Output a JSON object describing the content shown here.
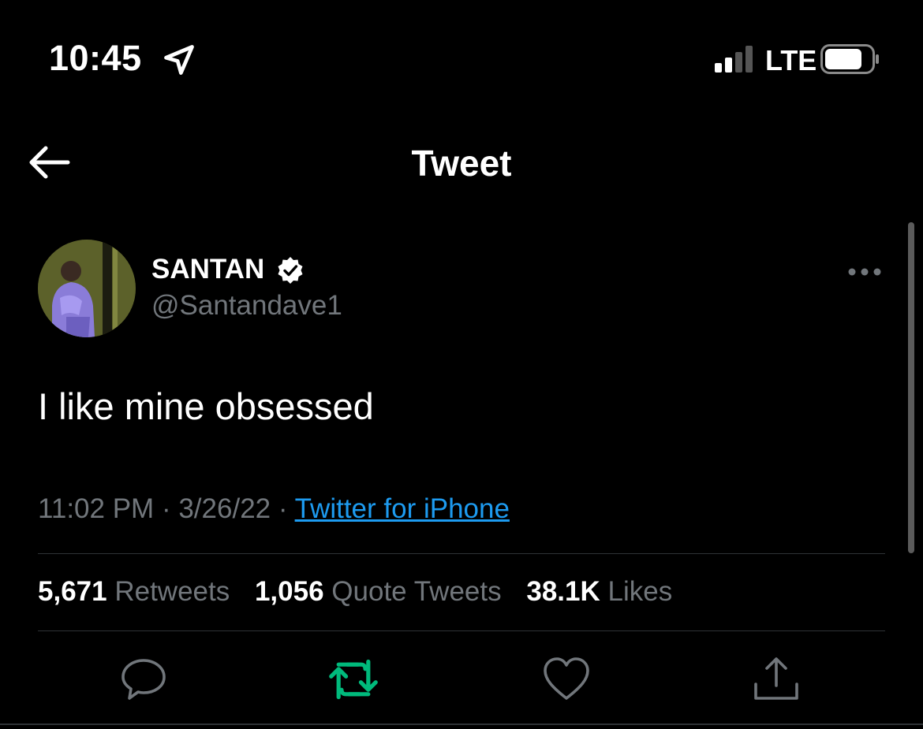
{
  "status_bar": {
    "time": "10:45",
    "network": "LTE",
    "icons": [
      "location-arrow-icon",
      "signal-bars-icon",
      "battery-icon"
    ]
  },
  "header": {
    "title": "Tweet",
    "back_icon": "arrow-left-icon"
  },
  "tweet": {
    "author_name": "SANTAN",
    "handle": "@Santandave1",
    "verified": true,
    "text": "I like mine obsessed",
    "time": "11:02 PM",
    "date": "3/26/22",
    "source": "Twitter for iPhone",
    "separator": "·"
  },
  "stats": {
    "retweets_count": "5,671",
    "retweets_label": "Retweets",
    "quotes_count": "1,056",
    "quotes_label": "Quote Tweets",
    "likes_count": "38.1K",
    "likes_label": "Likes"
  },
  "actions": [
    "reply-icon",
    "retweet-icon",
    "like-icon",
    "share-icon"
  ],
  "colors": {
    "background": "#000000",
    "text": "#ffffff",
    "muted": "#71767b",
    "link": "#1d9bf0",
    "retweet_active": "#00ba7c",
    "divider": "#2f3336",
    "verified_badge": "#ffffff"
  }
}
